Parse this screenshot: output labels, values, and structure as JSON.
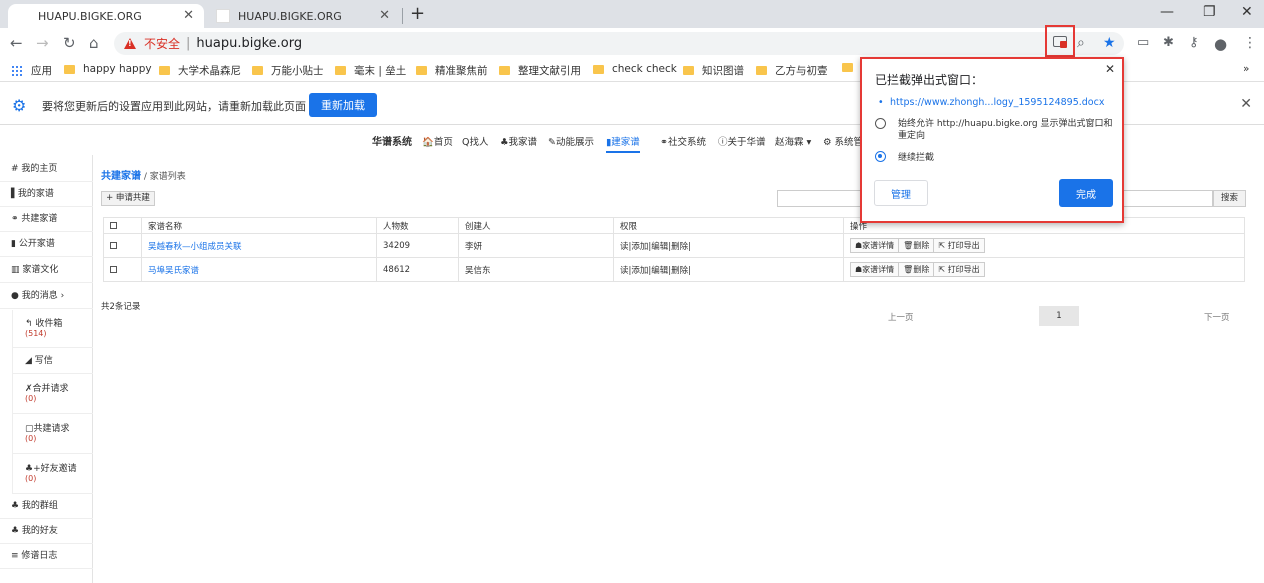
{
  "tabs": [
    {
      "title": "HUAPU.BIGKE.ORG",
      "active": true
    },
    {
      "title": "HUAPU.BIGKE.ORG",
      "active": false
    }
  ],
  "tab_close": "✕",
  "new_tab": "+",
  "window": {
    "minimize": "—",
    "restore": "❐",
    "close": "✕"
  },
  "nav": {
    "back": "←",
    "forward": "→",
    "reload": "↻",
    "home": "⌂"
  },
  "omnibox": {
    "security": "不安全",
    "separator": "|",
    "url": "huapu.bigke.org"
  },
  "toolbar_icons": {
    "zoom": "⌕",
    "star": "★",
    "ext1": "▭",
    "puzzle": "✱",
    "key": "⚷",
    "profile": "●",
    "menu": "⋮"
  },
  "bookmarks": [
    {
      "label": "应用",
      "type": "apps"
    },
    {
      "label": "happy happy",
      "type": "folder"
    },
    {
      "label": "大学术晶森尼",
      "type": "folder"
    },
    {
      "label": "万能小贴士",
      "type": "folder"
    },
    {
      "label": "毫末 | 垒土",
      "type": "folder"
    },
    {
      "label": "精准聚焦前",
      "type": "folder"
    },
    {
      "label": "整理文献引用",
      "type": "folder"
    },
    {
      "label": "check check",
      "type": "folder"
    },
    {
      "label": "知识图谱",
      "type": "folder"
    },
    {
      "label": "乙方与初壹",
      "type": "folder"
    }
  ],
  "bookmarks_more": "»",
  "infobar": {
    "icon": "⚙",
    "message": "要将您更新后的设置应用到此网站，请重新加载此页面",
    "button": "重新加载",
    "close": "✕"
  },
  "sitenav": [
    {
      "label": "华谱系统"
    },
    {
      "label": "🏠首页"
    },
    {
      "label": "Q找人"
    },
    {
      "label": "♣我家谱"
    },
    {
      "label": "✎动能展示"
    },
    {
      "label": "▮建家谱",
      "active": true
    },
    {
      "label": "⚭社交系统"
    },
    {
      "label": "ⓘ关于华谱"
    },
    {
      "label": "赵海霖 ▾"
    },
    {
      "label": "⚙ 系统管"
    }
  ],
  "sidebar": {
    "items": [
      {
        "label": "# 我的主页"
      },
      {
        "label": "▌我的家谱"
      },
      {
        "label": "⚭ 共建家谱"
      },
      {
        "label": "▮ 公开家谱"
      },
      {
        "label": "▥ 家谱文化"
      },
      {
        "label": "● 我的消息  ›"
      }
    ],
    "subitems": [
      {
        "label": "↰ 收件箱",
        "count": "(514)"
      },
      {
        "label": "◢ 写信",
        "count": ""
      },
      {
        "label": "✗合并请求",
        "count": "(0)"
      },
      {
        "label": "▢共建请求",
        "count": "(0)"
      },
      {
        "label": "♣+好友邀请",
        "count": "(0)"
      }
    ],
    "bottom": [
      {
        "label": "♣ 我的群组"
      },
      {
        "label": "♣ 我的好友"
      },
      {
        "label": "≡ 修谱日志"
      }
    ]
  },
  "main": {
    "breadcrumb": {
      "current": "共建家谱",
      "sep": " / ",
      "sub": "家谱列表"
    },
    "apply_button": "+ 申请共建",
    "search_button": "搜索",
    "columns": [
      "家谱名称",
      "人物数",
      "创建人",
      "权限",
      "操作"
    ],
    "rows": [
      {
        "name": "吴越春秋—小组成员关联",
        "count": "34209",
        "creator": "李妍",
        "perm": "读|添加|编辑|删除|"
      },
      {
        "name": "马埠吴氏家谱",
        "count": "48612",
        "creator": "吴信东",
        "perm": "读|添加|编辑|删除|"
      }
    ],
    "ops": [
      "☗家谱详情",
      "🗑删除",
      "⇱ 打印导出"
    ],
    "total": "共2条记录",
    "pager": {
      "prev": "上一页",
      "current": "1",
      "next": "下一页"
    }
  },
  "popup": {
    "title": "已拦截弹出式窗口：",
    "close": "✕",
    "blocked_url": "https://www.zhongh...logy_1595124895.docx",
    "option_allow": "始终允许 http://huapu.bigke.org 显示弹出式窗口和重定向",
    "option_block": "继续拦截",
    "manage": "管理",
    "done": "完成"
  }
}
